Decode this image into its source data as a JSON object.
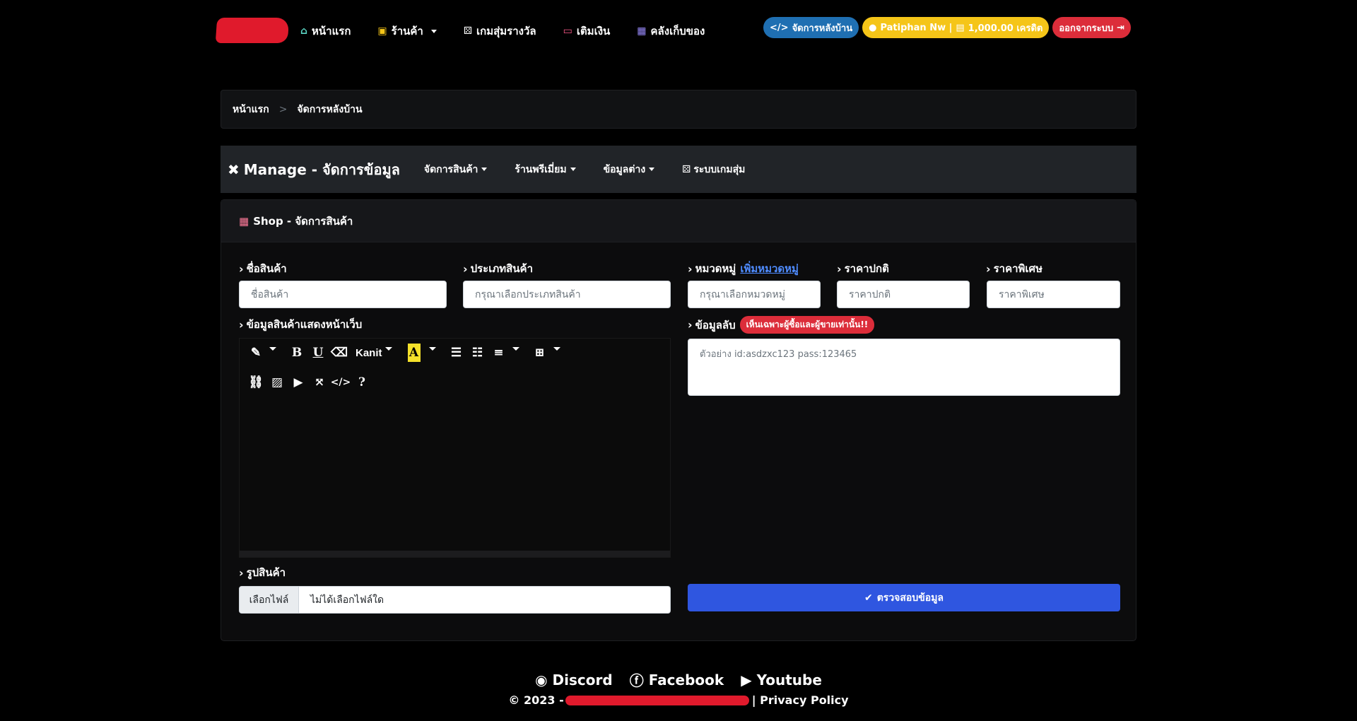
{
  "nav": {
    "items": [
      {
        "label": "หน้าแรก",
        "icon": "home-icon",
        "color": "#5bd6c4"
      },
      {
        "label": "ร้านค้า",
        "icon": "store-icon",
        "color": "#f5c518",
        "dropdown": true
      },
      {
        "label": "เกมสุ่มรางวัล",
        "icon": "dice-icon",
        "color": "#ffffff"
      },
      {
        "label": "เติมเงิน",
        "icon": "credit-card-icon",
        "color": "#ff5a8a"
      },
      {
        "label": "คลังเก็บของ",
        "icon": "box-icon",
        "color": "#9b8cff"
      }
    ],
    "admin_label": "จัดการหลังบ้าน",
    "user_label": "Patiphan Nw | ",
    "credit_label": "1,000.00 เครดิต",
    "logout_label": "ออกจากระบบ"
  },
  "breadcrumb": {
    "home": "หน้าแรก",
    "separator": ">",
    "current": "จัดการหลังบ้าน"
  },
  "manage": {
    "title": "Manage - จัดการข้อมูล",
    "menu": [
      {
        "label": "จัดการสินค้า"
      },
      {
        "label": "ร้านพรีเมี่ยม"
      },
      {
        "label": "ข้อมูลต่าง"
      },
      {
        "label": "ระบบเกมสุ่ม"
      }
    ]
  },
  "card": {
    "header": "Shop - จัดการสินค้า"
  },
  "form": {
    "name_label": "ชื่อสินค้า",
    "name_placeholder": "ชื่อสินค้า",
    "type_label": "ประเภทสินค้า",
    "type_placeholder": "กรุณาเลือกประเภทสินค้า",
    "category_label": "หมวดหมู่",
    "category_add_link": "เพิ่มหมวดหมู่",
    "category_placeholder": "กรุณาเลือกหมวดหมู่",
    "price_label": "ราคาปกติ",
    "price_placeholder": "ราคาปกติ",
    "special_price_label": "ราคาพิเศษ",
    "special_price_placeholder": "ราคาพิเศษ",
    "description_label": "ข้อมูลสินค้าแสดงหน้าเว็บ",
    "editor_font": "Kanit",
    "secret_label": "ข้อมูลลับ",
    "secret_badge": "เห็นเฉพาะผู้ซื้อและผู้ขายเท่านั้น!!",
    "secret_placeholder": "ตัวอย่าง id:asdzxc123 pass:123465",
    "image_label": "รูปสินค้า",
    "file_button": "เลือกไฟล์",
    "file_status": "ไม่ได้เลือกไฟล์ใด",
    "submit_label": "ตรวจสอบข้อมูล"
  },
  "footer": {
    "links": [
      {
        "label": "Discord",
        "icon": "discord-icon"
      },
      {
        "label": "Facebook",
        "icon": "facebook-icon"
      },
      {
        "label": "Youtube",
        "icon": "youtube-icon"
      }
    ],
    "copyright_prefix": "© 2023 -",
    "privacy": "| Privacy Policy"
  },
  "colors": {
    "accent_blue": "#2f56e0",
    "admin_pill": "#1f6fb2",
    "credit_pill": "#f5c518",
    "logout_pill": "#dc2d3a"
  }
}
